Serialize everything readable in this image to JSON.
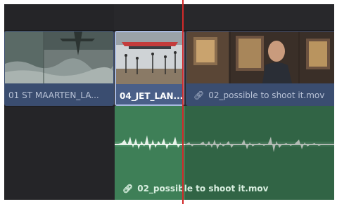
{
  "timeline": {
    "video_track": {
      "clips": [
        {
          "name": "01 ST MAARTEN_LA...",
          "selected": false
        },
        {
          "name": "04_JET_LAN...",
          "selected": true
        },
        {
          "name": "02_possible to shoot it.mov",
          "linked": true,
          "link_icon": "link-icon",
          "selected": false
        }
      ]
    },
    "audio_track": {
      "clip": {
        "name": "02_possible to shoot it.mov",
        "linked": true,
        "link_icon": "link-icon"
      }
    },
    "playhead": {
      "color": "#d22a2a"
    }
  },
  "colors": {
    "video_clip": "#3a4d70",
    "video_clip_selected_border": "#a7b9e0",
    "audio_clip": "#3e7f57",
    "waveform": "#e8f2ea",
    "background": "#28282b"
  }
}
